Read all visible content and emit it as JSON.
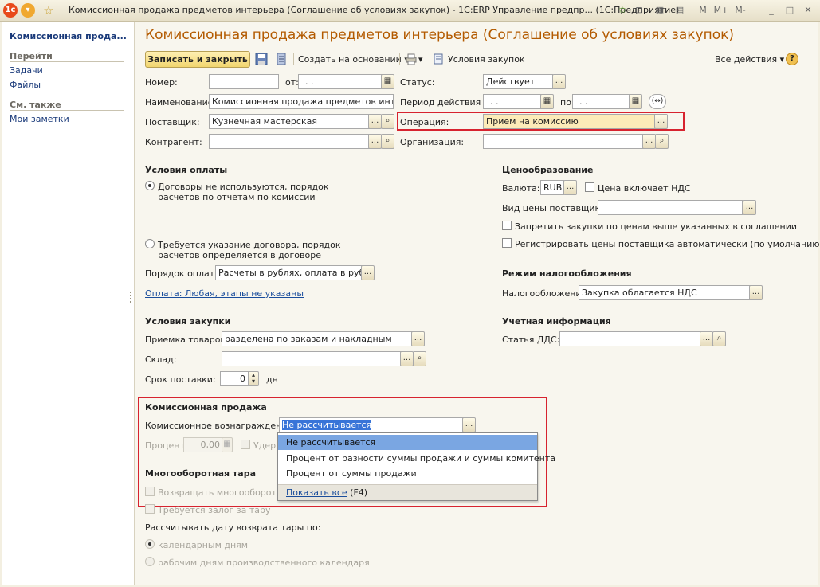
{
  "window": {
    "title": "Комиссионная продажа предметов интерьера (Соглашение об условиях закупок) - 1C:ERP Управление предпр...  (1С:Предприятие)",
    "controls": {
      "m": "M",
      "mplus": "M+",
      "mminus": "M-",
      "minimize": "_",
      "restore": "□",
      "close": "✕"
    }
  },
  "sidebar": {
    "title": "Комиссионная прода...",
    "goto_header": "Перейти",
    "goto_items": [
      "Задачи",
      "Файлы"
    ],
    "see_also_header": "См. также",
    "see_also_items": [
      "Мои заметки"
    ]
  },
  "form": {
    "title": "Комиссионная продажа предметов интерьера (Соглашение об условиях закупок)",
    "toolbar": {
      "save_close": "Записать и закрыть",
      "create_based": "Создать на основании",
      "purchase_terms": "Условия закупок",
      "all_actions": "Все действия",
      "help": "?"
    },
    "fields": {
      "number_label": "Номер:",
      "number_value": "",
      "from_label": "от:",
      "from_value": ". .",
      "status_label": "Статус:",
      "status_value": "Действует",
      "name_label": "Наименование:",
      "name_value": "Комиссионная продажа предметов интерьера",
      "period_label": "Период действия с:",
      "period_from": ". .",
      "period_to_label": "по:",
      "period_to": ". .",
      "supplier_label": "Поставщик:",
      "supplier_value": "Кузнечная мастерская",
      "operation_label": "Операция:",
      "operation_value": "Прием на комиссию",
      "contractor_label": "Контрагент:",
      "contractor_value": "",
      "organization_label": "Организация:",
      "organization_value": ""
    },
    "payment": {
      "header": "Условия оплаты",
      "option1_line1": "Договоры не используются, порядок",
      "option1_line2": "расчетов по отчетам по комиссии",
      "option2_line1": "Требуется указание договора, порядок",
      "option2_line2": "расчетов определяется в договоре",
      "order_label": "Порядок оплаты:",
      "order_value": "Расчеты в рублях, оплата в рублях",
      "link": "Оплата: Любая, этапы не указаны"
    },
    "pricing": {
      "header": "Ценообразование",
      "currency_label": "Валюта:",
      "currency_value": "RUB",
      "price_includes_vat": "Цена включает НДС",
      "supplier_price_type_label": "Вид цены поставщика:",
      "supplier_price_type_value": "",
      "forbid_higher": "Запретить закупки по ценам выше указанных в соглашении",
      "register_auto": "Регистрировать цены поставщика автоматически (по умолчанию)"
    },
    "tax": {
      "header": "Режим налогообложения",
      "label": "Налогообложение:",
      "value": "Закупка облагается НДС"
    },
    "purchase": {
      "header": "Условия закупки",
      "acceptance_label": "Приемка товаров:",
      "acceptance_value": "разделена по заказам и накладным",
      "warehouse_label": "Склад:",
      "warehouse_value": "",
      "delivery_label": "Срок поставки:",
      "delivery_value": "0",
      "delivery_unit": "дн"
    },
    "accounting": {
      "header": "Учетная информация",
      "dds_label": "Статья ДДС:",
      "dds_value": ""
    },
    "commission": {
      "header": "Комиссионная продажа",
      "reward_label": "Комиссионное вознаграждение:",
      "reward_value": "Не рассчитывается",
      "percent_label": "Процент:",
      "percent_value": "0,00",
      "withhold_label": "Удерж"
    },
    "dropdown": {
      "items": [
        "Не рассчитывается",
        "Процент от разности суммы продажи и суммы комитента",
        "Процент от суммы продажи"
      ],
      "show_all": "Показать все",
      "show_all_key": "(F4)"
    },
    "tare": {
      "header": "Многооборотная тара",
      "return_label": "Возвращать многооборотную",
      "deposit_label": "Требуется залог за тару",
      "calc_date_label": "Рассчитывать дату возврата тары по:",
      "calendar_days": "календарным дням",
      "working_days": "рабочим дням производственного календаря"
    }
  }
}
